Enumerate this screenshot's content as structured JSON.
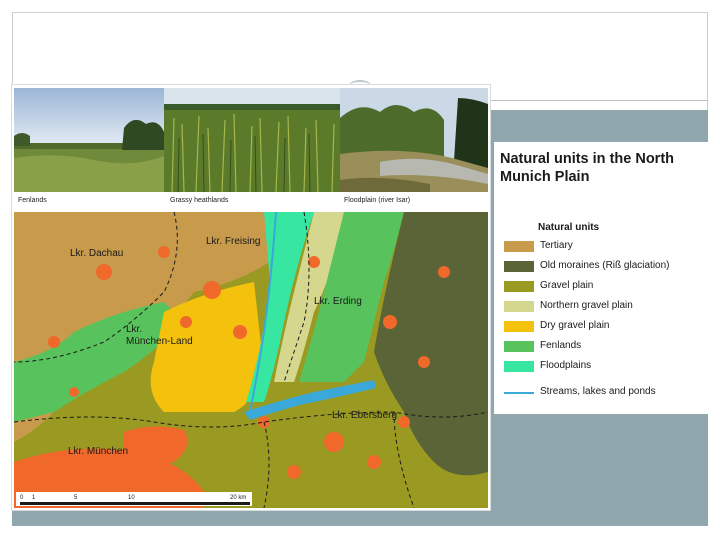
{
  "photos": [
    {
      "caption": "Fenlands"
    },
    {
      "caption": "Grassy heathlands"
    },
    {
      "caption": "Floodplain (river Isar)"
    }
  ],
  "legend": {
    "title": "Natural units in the North Munich Plain",
    "heading": "Natural units",
    "items": [
      {
        "label": "Tertiary",
        "color": "#c79a4c",
        "kind": "box"
      },
      {
        "label": "Old moraines (Riß glaciation)",
        "color": "#5a6436",
        "kind": "box"
      },
      {
        "label": "Gravel plain",
        "color": "#9a9a22",
        "kind": "box"
      },
      {
        "label": "Northern gravel plain",
        "color": "#d6d78e",
        "kind": "box"
      },
      {
        "label": "Dry gravel plain",
        "color": "#f4c20c",
        "kind": "box"
      },
      {
        "label": "Fenlands",
        "color": "#58c35c",
        "kind": "box"
      },
      {
        "label": "Floodplains",
        "color": "#37e6a0",
        "kind": "box"
      },
      {
        "label": "Streams, lakes and ponds",
        "color": "#3aa8d8",
        "kind": "line"
      }
    ]
  },
  "map": {
    "district_labels": [
      "Lkr. Dachau",
      "Lkr. Freising",
      "Lkr. Erding",
      "Lkr.",
      "München-Land",
      "Lkr. Ebersberg",
      "Lkr. München"
    ],
    "scale_ticks": [
      "0",
      "1",
      "5",
      "10",
      "20 km"
    ],
    "settlement_color": "#f0682a"
  }
}
